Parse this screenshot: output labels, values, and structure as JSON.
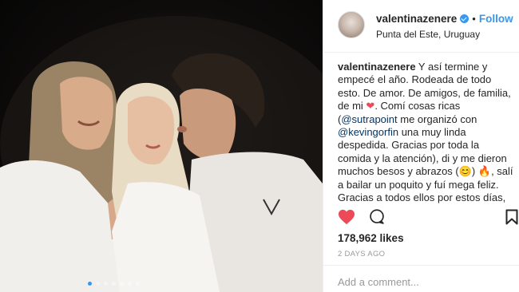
{
  "post": {
    "username": "valentinazenere",
    "follow_label": "Follow",
    "separator": "•",
    "location": "Punta del Este, Uruguay",
    "caption": {
      "text_1": " Y así termine y empecé el año. Rodeada de todo esto. De amor. De amigos, de familia, de mi ",
      "text_2": ". Comí cosas ricas (",
      "mention_1": "@sutrapoint",
      "text_3": " me organizó con ",
      "mention_2": "@kevingorfin",
      "text_4": " una muy linda despedida. Gracias por toda la comida y la atención), di y me dieron muchos besos y abrazos (",
      "text_5": ") ",
      "text_6": ", salí a bailar un poquito y fuí mega feliz. Gracias a todos ellos por estos días, gracias por apoyarme siempre. Es muy lindo e importante tener amigos y familia así de presentes como ellos, que me bajan a la realidad y me recuerdan lo que realmente importa."
    },
    "likes": "178,962 likes",
    "time": "2 DAYS AGO",
    "comment_placeholder": "Add a comment..."
  },
  "icons": {
    "like": "heart-filled-icon",
    "comment": "comment-bubble-icon",
    "save": "bookmark-icon",
    "verified": "verified-badge-icon",
    "emoji_heart": "red-heart-emoji",
    "emoji_smile": "smiling-face-emoji",
    "emoji_fire": "fire-emoji"
  },
  "colors": {
    "accent": "#3897f0",
    "like": "#ed4956",
    "mention": "#003569",
    "text": "#262626",
    "muted": "#999999"
  },
  "carousel": {
    "slides": 7,
    "active_index": 0
  }
}
